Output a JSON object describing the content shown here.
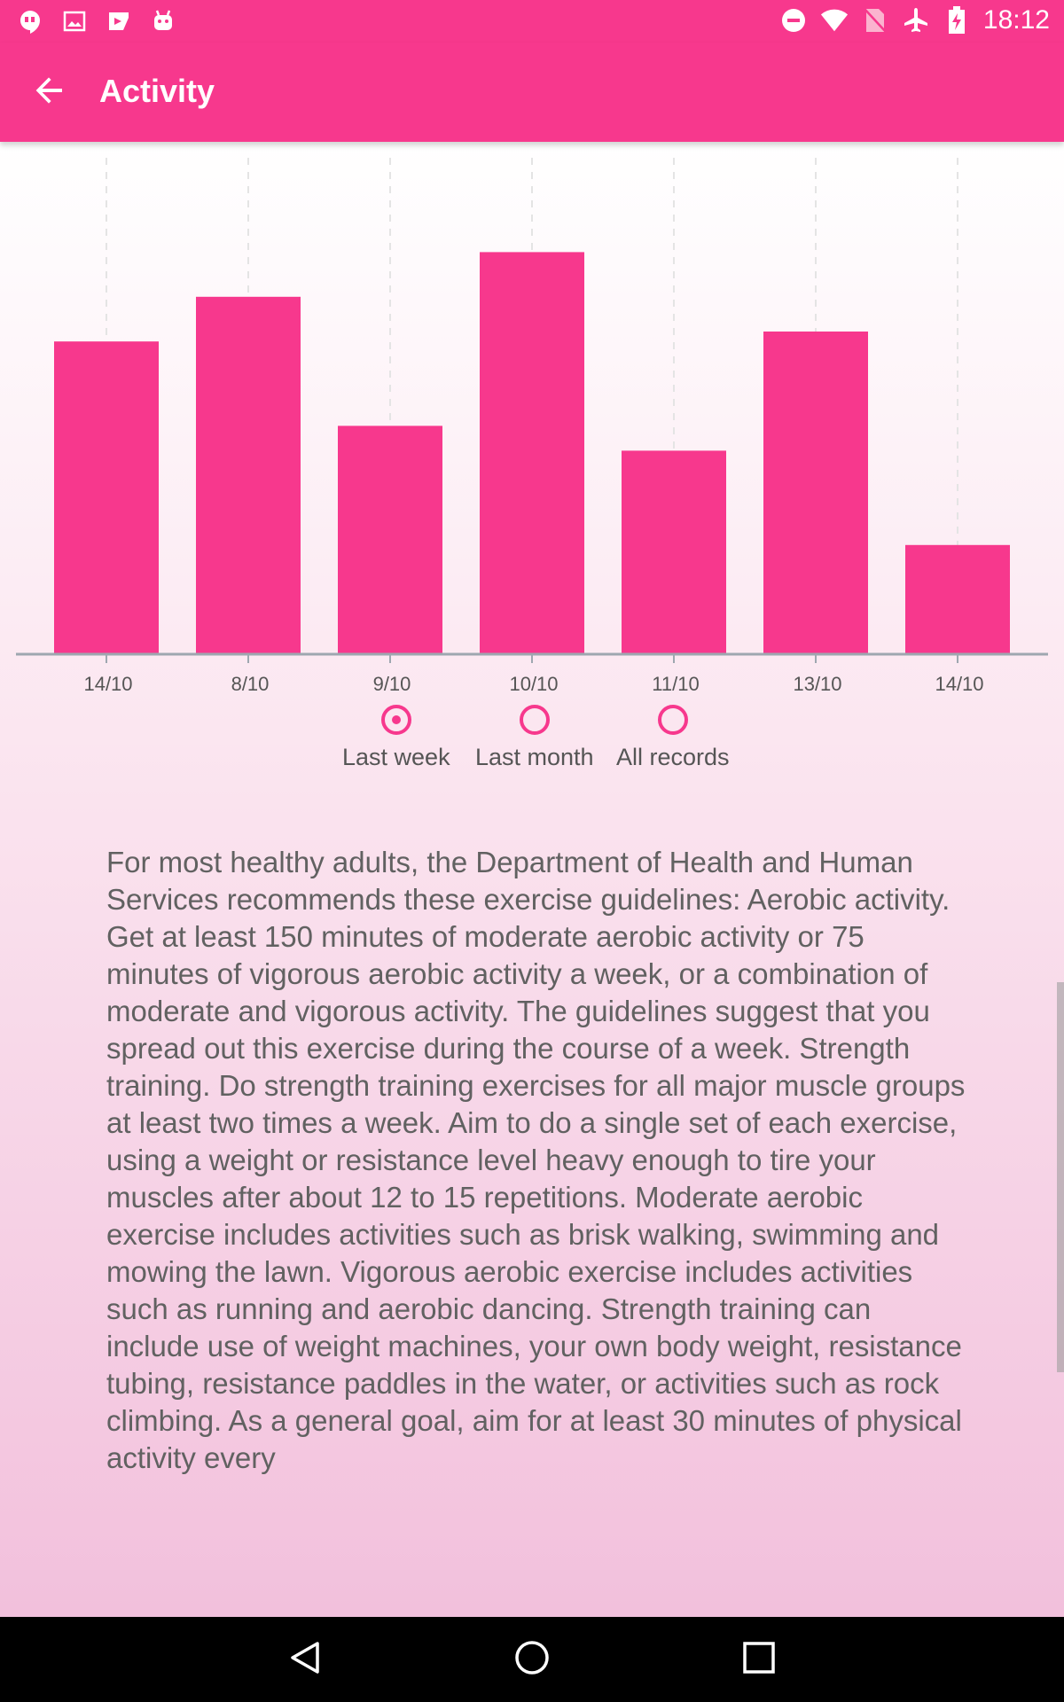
{
  "status_bar": {
    "time": "18:12",
    "left_icons": [
      "hangouts-icon",
      "image-icon",
      "play-store-icon",
      "android-icon"
    ],
    "right_icons": [
      "do-not-disturb-icon",
      "wifi-icon",
      "no-sim-icon",
      "airplane-mode-icon",
      "battery-charging-icon"
    ]
  },
  "app_bar": {
    "title": "Activity",
    "back_icon": "arrow-back-icon"
  },
  "chart_data": {
    "type": "bar",
    "categories": [
      "14/10",
      "8/10",
      "9/10",
      "10/10",
      "11/10",
      "13/10",
      "14/10"
    ],
    "values": [
      0.63,
      0.72,
      0.46,
      0.81,
      0.41,
      0.65,
      0.22
    ],
    "bar_color": "#f7388d",
    "axis_color": "#9ea7b0",
    "grid": "vertical dashed",
    "ylim": [
      0,
      1
    ],
    "title": "",
    "xlabel": "",
    "ylabel": ""
  },
  "range_selector": {
    "options": [
      {
        "label": "Last week",
        "selected": true
      },
      {
        "label": "Last month",
        "selected": false
      },
      {
        "label": "All records",
        "selected": false
      }
    ]
  },
  "description": "For most healthy adults, the Department of Health and Human Services recommends these exercise guidelines: Aerobic activity. Get at least 150 minutes of moderate aerobic activity or 75 minutes of vigorous aerobic activity a week, or a combination of moderate and vigorous activity. The guidelines suggest that you spread out this exercise during the course of a week. Strength training. Do strength training exercises for all major muscle groups at least two times a week. Aim to do a single set of each exercise, using a weight or resistance level heavy enough to tire your muscles after about 12 to 15 repetitions. Moderate aerobic exercise includes activities such as brisk walking, swimming and mowing the lawn. Vigorous aerobic exercise includes activities such as running and aerobic dancing. Strength training can include use of weight machines, your own body weight, resistance tubing, resistance paddles in the water, or activities such as rock climbing.  As a general goal, aim for at least 30 minutes of physical activity every",
  "nav_bar": {
    "buttons": [
      "back-nav-icon",
      "home-nav-icon",
      "recents-nav-icon"
    ]
  },
  "colors": {
    "accent": "#f7388d",
    "text": "#616161"
  }
}
